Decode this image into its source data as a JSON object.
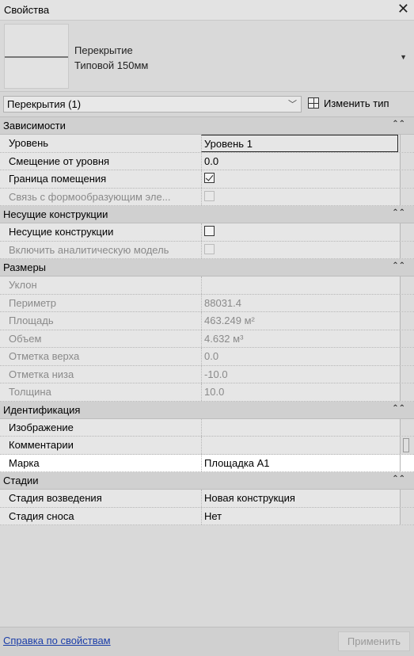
{
  "window": {
    "title": "Свойства",
    "close_symbol": "✕"
  },
  "type_selector": {
    "category": "Перекрытие",
    "type_name": "Типовой 150мм"
  },
  "instance_filter": {
    "label": "Перекрытия (1)"
  },
  "edit_type": {
    "label": "Изменить тип"
  },
  "sections": [
    {
      "name": "Зависимости",
      "rows": [
        {
          "name": "Уровень",
          "value": "Уровень 1",
          "editing": true
        },
        {
          "name": "Смещение от уровня",
          "value": "0.0"
        },
        {
          "name": "Граница помещения",
          "checkbox": true,
          "checked": true
        },
        {
          "name": "Связь с формообразующим эле...",
          "checkbox": true,
          "checked": false,
          "disabled": true
        }
      ]
    },
    {
      "name": "Несущие конструкции",
      "rows": [
        {
          "name": "Несущие конструкции",
          "checkbox": true,
          "checked": false
        },
        {
          "name": "Включить аналитическую модель",
          "checkbox": true,
          "checked": false,
          "disabled": true
        }
      ]
    },
    {
      "name": "Размеры",
      "rows": [
        {
          "name": "Уклон",
          "value": "",
          "disabled": true
        },
        {
          "name": "Периметр",
          "value": "88031.4",
          "disabled": true
        },
        {
          "name": "Площадь",
          "value": "463.249 м²",
          "disabled": true
        },
        {
          "name": "Объем",
          "value": "4.632 м³",
          "disabled": true
        },
        {
          "name": "Отметка верха",
          "value": "0.0",
          "disabled": true
        },
        {
          "name": "Отметка низа",
          "value": "-10.0",
          "disabled": true
        },
        {
          "name": "Толщина",
          "value": "10.0",
          "disabled": true
        }
      ]
    },
    {
      "name": "Идентификация",
      "rows": [
        {
          "name": "Изображение",
          "value": ""
        },
        {
          "name": "Комментарии",
          "value": "",
          "scroll_thumb": true
        },
        {
          "name": "Марка",
          "value": "Площадка А1",
          "selected": true
        }
      ]
    },
    {
      "name": "Стадии",
      "rows": [
        {
          "name": "Стадия возведения",
          "value": "Новая конструкция"
        },
        {
          "name": "Стадия сноса",
          "value": "Нет"
        }
      ]
    }
  ],
  "footer": {
    "help_link": "Справка по свойствам",
    "apply_button": "Применить"
  },
  "colors": {
    "panel_bg": "#d9d9d9",
    "row_bg": "#e6e6e6",
    "selected_row_bg": "#ffffff",
    "link": "#1b3ea8"
  }
}
